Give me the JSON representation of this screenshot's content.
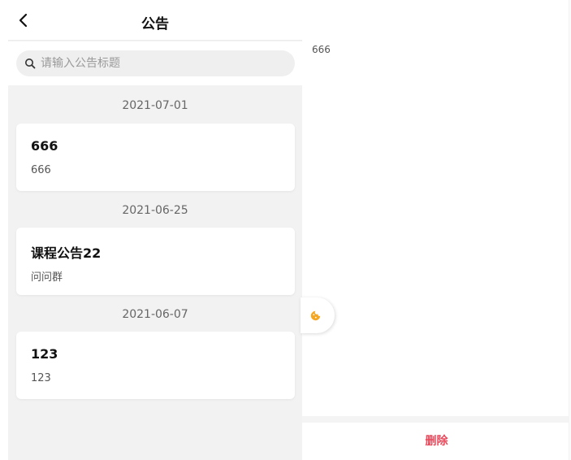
{
  "header": {
    "title": "公告",
    "back_icon": "chevron-left-icon"
  },
  "search": {
    "placeholder": "请输入公告标题",
    "value": "",
    "icon": "search-icon"
  },
  "announcements": [
    {
      "date": "2021-07-01",
      "title": "666",
      "content": "666"
    },
    {
      "date": "2021-06-25",
      "title": "课程公告22",
      "content": "问问群"
    },
    {
      "date": "2021-06-07",
      "title": "123",
      "content": "123"
    }
  ],
  "detail": {
    "content": "666",
    "floating_icon": "cookie-icon"
  },
  "footer": {
    "delete_label": "删除"
  },
  "colors": {
    "danger": "#e8485a",
    "accent": "#f5a623",
    "panel_bg": "#f2f2f2"
  }
}
